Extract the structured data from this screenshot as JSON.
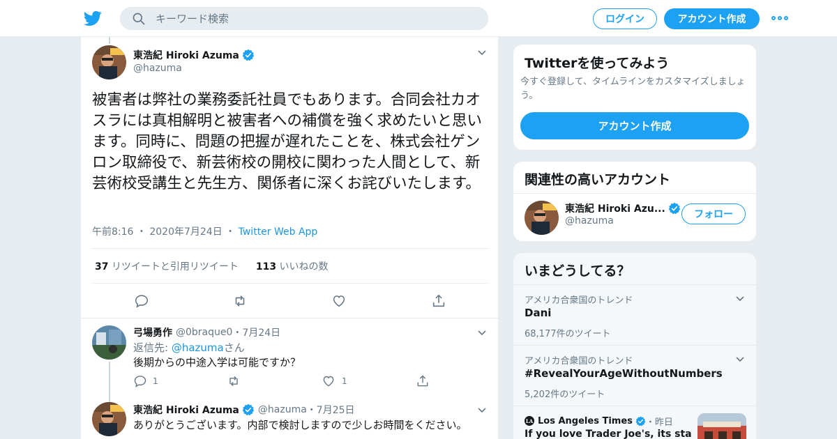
{
  "header": {
    "search_placeholder": "キーワード検索",
    "login_label": "ログイン",
    "signup_label": "アカウント作成",
    "brand_color": "#1da1f2"
  },
  "main_tweet": {
    "author_name": "東浩紀 Hiroki Azuma",
    "author_handle": "@hazuma",
    "text": "被害者は弊社の業務委託社員でもあります。合同会社カオスラには真相解明と被害者への補償を強く求めたいと思います。同時に、問題の把握が遅れたことを、株式会社ゲンロン取締役で、新芸術校の開校に関わった人間として、新芸術校受講生と先生方、関係者に深くお詫びいたします。",
    "time": "午前8:16",
    "date": "2020年7月24日",
    "source": "Twitter Web App",
    "retweet_count": "37",
    "retweet_label": "リツイートと引用リツイート",
    "like_count": "113",
    "like_label": "いいねの数"
  },
  "replies": [
    {
      "author_name": "弓場勇作",
      "author_handle": "@0braque0",
      "date": "7月24日",
      "reply_to_prefix": "返信先: ",
      "reply_to_handle": "@hazuma",
      "reply_to_suffix": "さん",
      "text": "後期からの中途入学は可能ですか？",
      "reply_count": "1",
      "like_count": "1"
    },
    {
      "author_name": "東浩紀 Hiroki Azuma",
      "author_handle": "@hazuma",
      "date": "7月25日",
      "text": "ありがとうございます。内部で検討しますので少しお時間をください。"
    }
  ],
  "sidebar": {
    "signup_card": {
      "title": "Twitterを使ってみよう",
      "description": "今すぐ登録して、タイムラインをカスタマイズしましょう。",
      "button_label": "アカウント作成"
    },
    "related_card": {
      "title": "関連性の高いアカウント",
      "account_name": "東浩紀 Hiroki Azu...",
      "account_handle": "@hazuma",
      "follow_label": "フォロー"
    },
    "trends_card": {
      "title": "いまどうしてる？",
      "trends": [
        {
          "context": "アメリカ合衆国のトレンド",
          "name": "Dani",
          "count": "68,177件のツイート"
        },
        {
          "context": "アメリカ合衆国のトレンド",
          "name": "#RevealYourAgeWithoutNumbers",
          "count": "5,202件のツイート"
        }
      ],
      "news": {
        "source": "Los Angeles Times",
        "time": "昨日",
        "text": "If you love Trader Joe's, its stances"
      }
    }
  }
}
